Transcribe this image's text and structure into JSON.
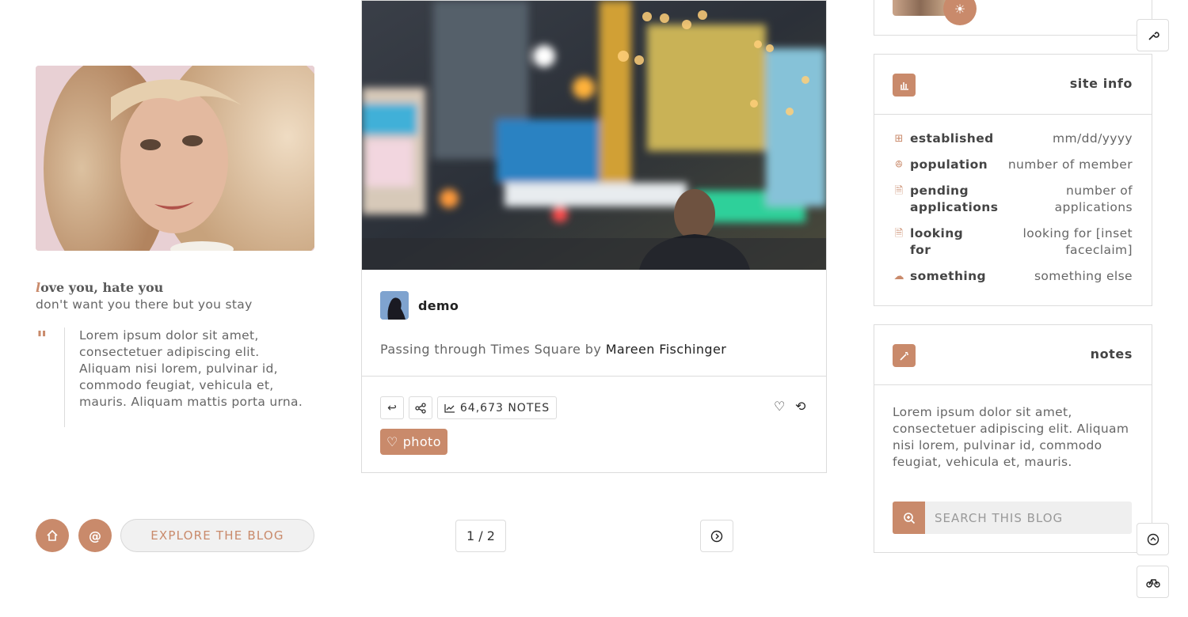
{
  "colors": {
    "accent": "#c98a6b",
    "border": "#dcdcdc",
    "text": "#555555"
  },
  "left": {
    "tagline_first": "l",
    "tagline_rest": "ove you, hate you",
    "subline": "don't want you there but you stay",
    "quote": "Lorem ipsum dolor sit amet, consectetuer adipiscing elit. Aliquam nisi lorem, pulvinar id, commodo feugiat, vehicula et, mauris. Aliquam mattis porta urna.",
    "nav": {
      "home_icon": "home-icon",
      "ask_icon": "at-icon",
      "explore_label": "EXPLORE THE BLOG"
    }
  },
  "post": {
    "author": "demo",
    "caption_prefix": "Passing through Times Square by ",
    "caption_link": "Mareen Fischinger",
    "notes_count": "64,673 NOTES",
    "tag": "photo"
  },
  "pagination": {
    "label": "1 / 2"
  },
  "sidebar": {
    "site_info": {
      "title": "site info",
      "rows": [
        {
          "key": "established",
          "value": "mm/dd/yyyy",
          "icon": "cake-icon"
        },
        {
          "key": "population",
          "value": "number of member",
          "icon": "people-icon"
        },
        {
          "key": "pending applications",
          "value": "number of applications",
          "icon": "document-plus-icon"
        },
        {
          "key": "looking for",
          "value": "looking for [inset faceclaim]",
          "icon": "document-search-icon"
        },
        {
          "key": "something",
          "value": "something else",
          "icon": "cloud-icon"
        }
      ]
    },
    "notes": {
      "title": "notes",
      "text": "Lorem ipsum dolor sit amet, consectetuer adipiscing elit. Aliquam nisi lorem, pulvinar id, commodo feugiat, vehicula et, mauris.",
      "search_placeholder": "SEARCH THIS BLOG"
    }
  },
  "floating": {
    "top_icon": "wrench-icon",
    "scroll_top_icon": "arrow-up-circle-icon",
    "theme_credit_icon": "bike-icon"
  }
}
